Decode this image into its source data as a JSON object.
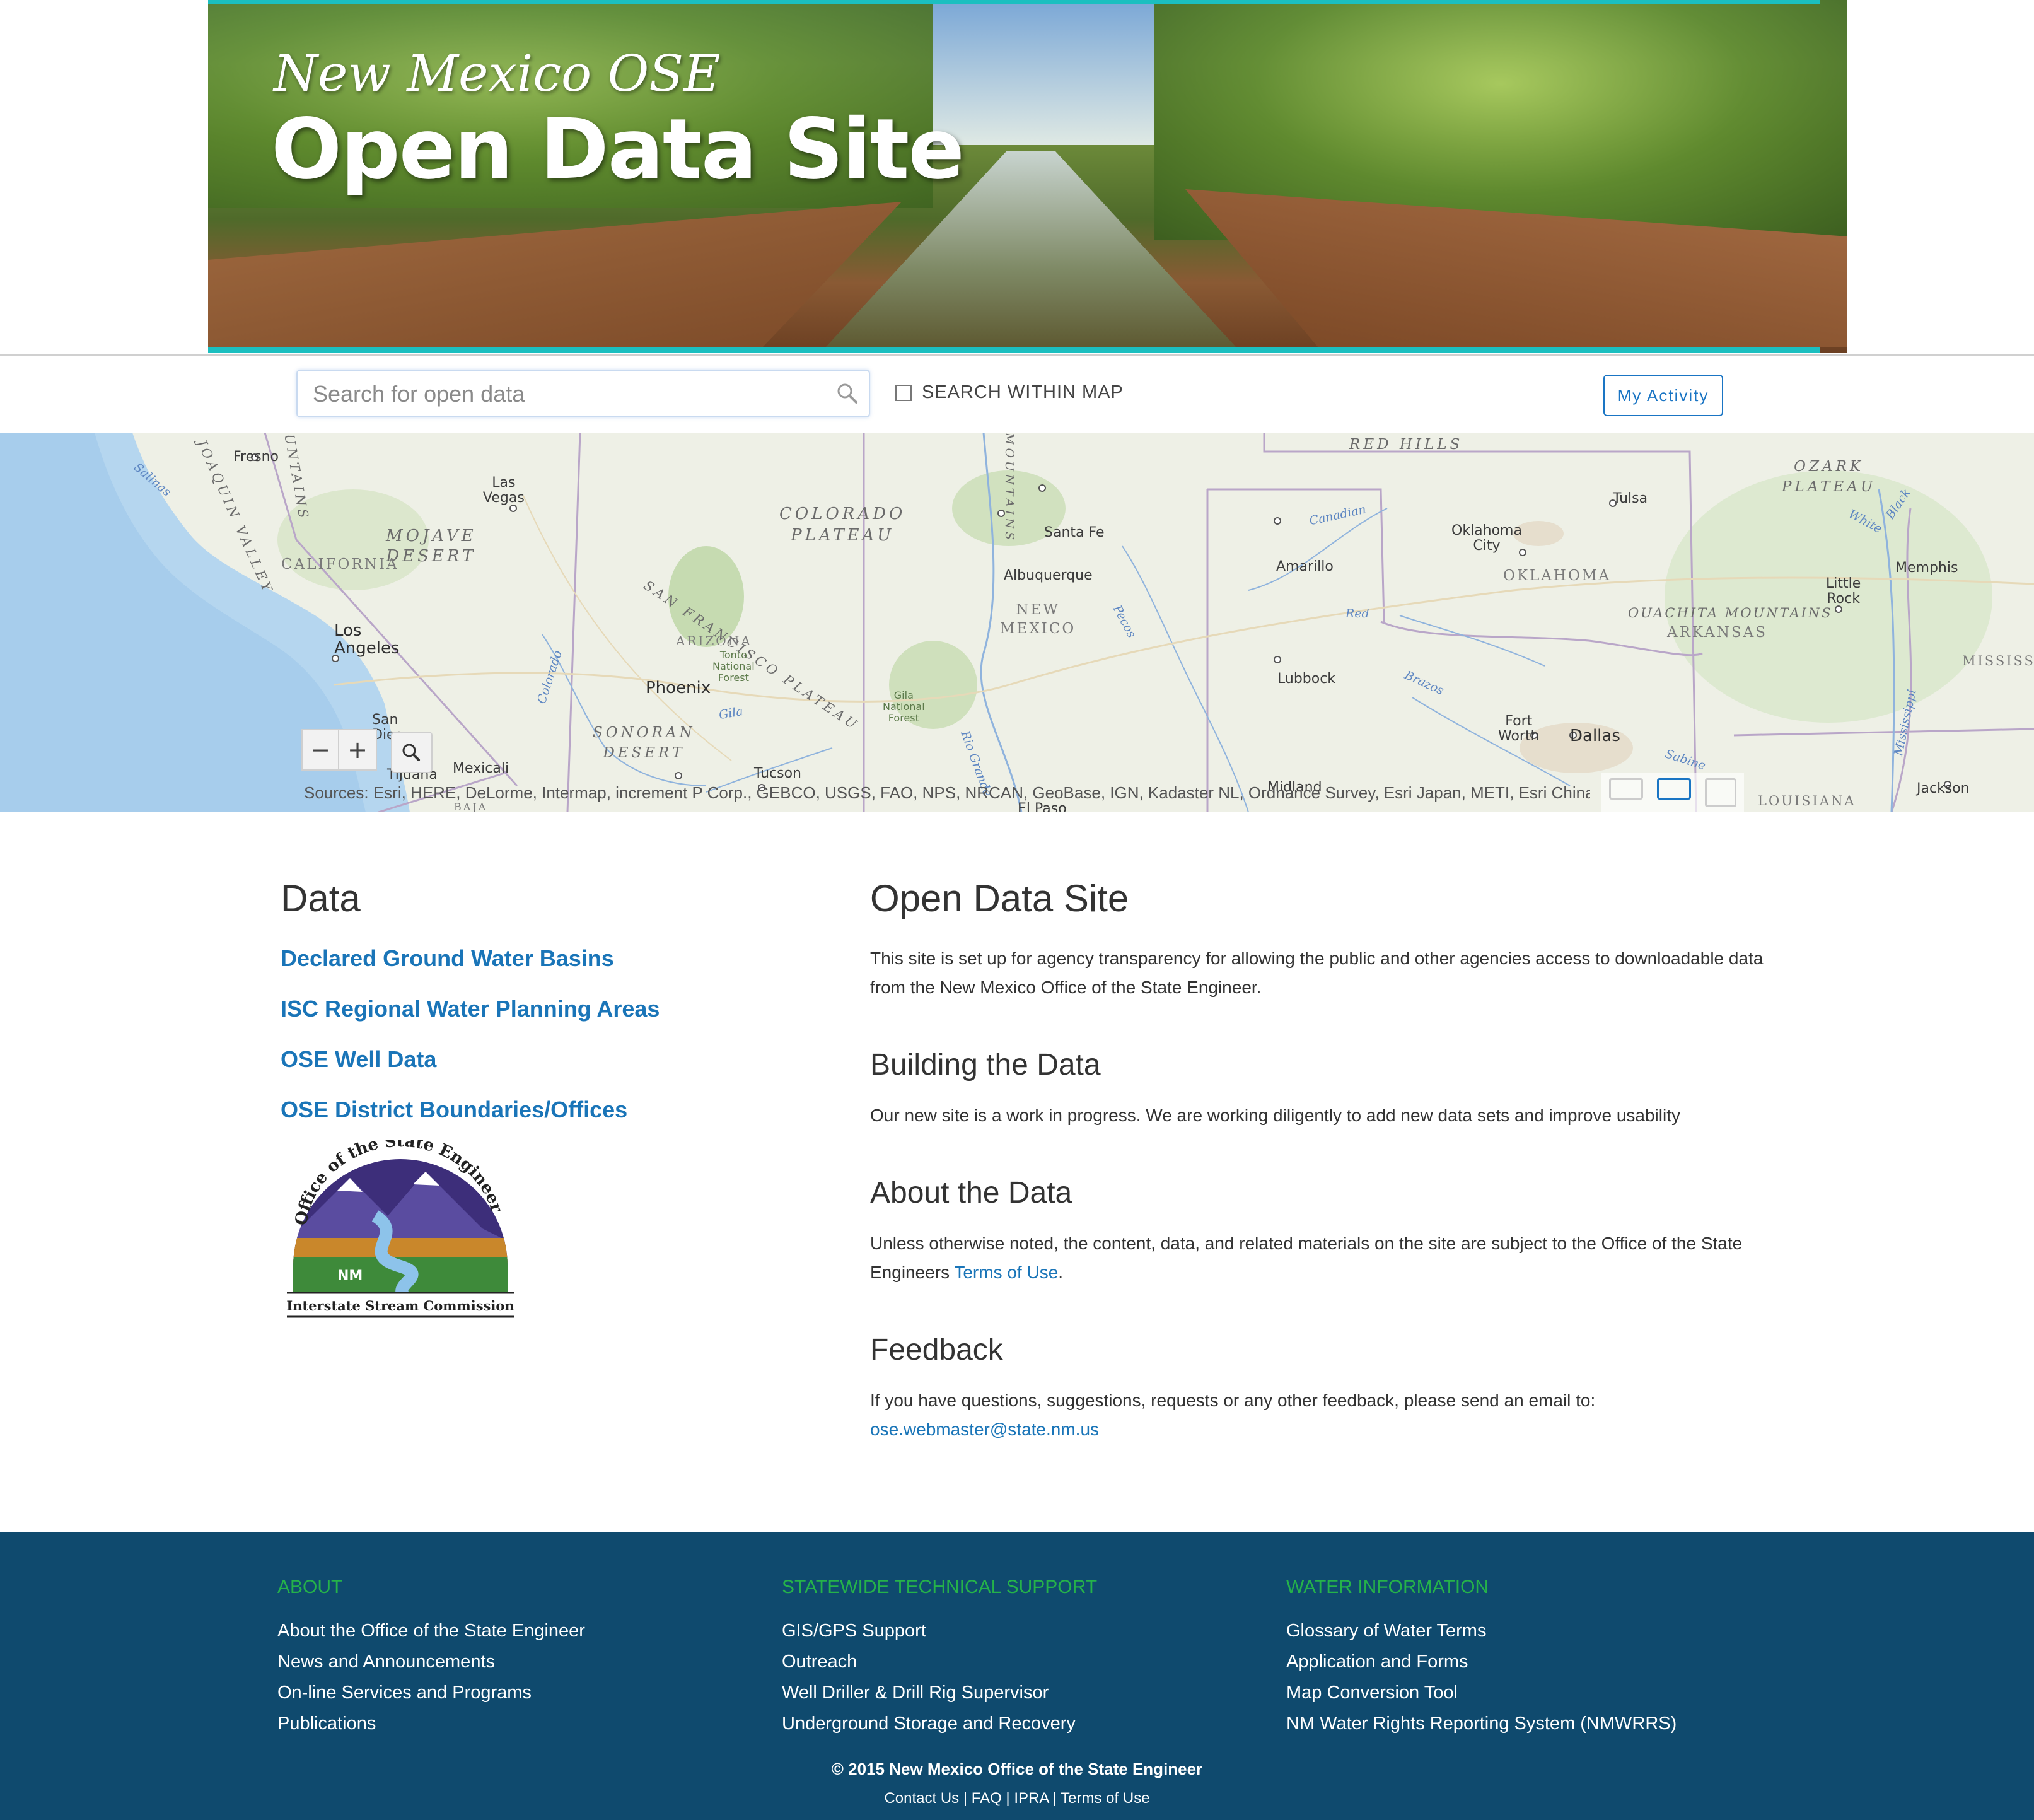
{
  "banner": {
    "subtitle": "New Mexico OSE",
    "title": "Open Data Site"
  },
  "search": {
    "placeholder": "Search for open data",
    "within_map_label": "SEARCH WITHIN MAP",
    "my_activity_label": "My Activity"
  },
  "map": {
    "zoom_out": "−",
    "zoom_in": "+",
    "attribution": "Sources: Esri, HERE, DeLorme, Intermap, increment P Corp., GEBCO, USGS, FAO, NPS, NRCAN, GeoBase, IGN, Kadaster NL, Ordnance Survey, Esri Japan, METI, Esri China (H",
    "labels": {
      "fresno": "Fresno",
      "las_vegas": "Las\nVegas",
      "mojave": "MOJAVE\nDESERT",
      "california": "CALIFORNIA",
      "los_angeles": "Los\nAngeles",
      "san_diego": "San\nDieg",
      "tijuana": "Tijuana",
      "mexicali": "Mexicali",
      "baja": "BAJA",
      "colorado_plateau": "COLORADO\nPLATEAU",
      "sf_plateau": "SAN FRANCISCO PLATEAU",
      "arizona": "ARIZONA",
      "tonto": "Tonto\nNational\nForest",
      "phoenix": "Phoenix",
      "sonoran": "SONORAN\nDESERT",
      "tucson": "Tucson",
      "gila_forest": "Gila\nNational\nForest",
      "santa_fe": "Santa Fe",
      "albuquerque": "Albuquerque",
      "new_mexico": "NEW\nMEXICO",
      "el_paso": "El Paso",
      "red_hills": "RED HILLS",
      "amarillo": "Amarillo",
      "lubbock": "Lubbock",
      "midland": "Midland",
      "oklahoma_city": "Oklahoma\nCity",
      "oklahoma": "OKLAHOMA",
      "tulsa": "Tulsa",
      "fort_worth": "Fort\nWorth",
      "dallas": "Dallas",
      "ozark": "OZARK\nPLATEAU",
      "ouachita": "OUACHITA MOUNTAINS",
      "arkansas": "ARKANSAS",
      "little_rock": "Little\nRock",
      "memphis": "Memphis",
      "mississippi": "MISSISSIPI",
      "jackson": "Jackson",
      "louisiana": "LOUISIANA",
      "canadian": "Canadian",
      "red": "Red",
      "brazos": "Brazos",
      "pecos": "Pecos",
      "sabine": "Sabine",
      "gila": "Gila",
      "colorado_river": "Colorado",
      "rio_grande": "Rio Grande",
      "salinas": "Salinas",
      "white": "White",
      "black": "Black",
      "mississippi_river": "Mississippi",
      "joaquin": "JOAQUIN VALLEY",
      "mountains": "UNTAINS",
      "mountains2": "MOUNTAINS"
    }
  },
  "data_section": {
    "heading": "Data",
    "links": [
      "Declared Ground Water Basins",
      "ISC Regional Water Planning Areas",
      "OSE Well Data",
      "OSE District Boundaries/Offices"
    ]
  },
  "logo": {
    "arc_text": "Office of the State Engineer",
    "center_text": "NM",
    "bottom_text": "Interstate Stream Commission"
  },
  "info": {
    "heading": "Open Data Site",
    "intro": "This site is set up for agency transparency for allowing the public and other agencies access to downloadable data from the New Mexico Office of the State Engineer.",
    "building_heading": "Building the Data",
    "building_text": "Our new site is a work in progress. We are working diligently to add new data sets and improve usability",
    "about_heading": "About the Data",
    "about_text_before": "Unless otherwise noted, the content, data, and related materials on the site are subject to the Office of the State Engineers ",
    "about_link": "Terms of Use",
    "about_text_after": ".",
    "feedback_heading": "Feedback",
    "feedback_text": "If you have questions, suggestions, requests or any other feedback, please send an email to:",
    "feedback_email": "ose.webmaster@state.nm.us"
  },
  "footer": {
    "about": {
      "heading": "ABOUT",
      "links": [
        "About the Office of the State Engineer",
        "News and Announcements",
        "On-line Services and Programs",
        "Publications"
      ]
    },
    "support": {
      "heading": "STATEWIDE TECHNICAL SUPPORT",
      "links": [
        "GIS/GPS Support",
        "Outreach",
        "Well Driller & Drill Rig Supervisor",
        "Underground Storage and Recovery"
      ]
    },
    "water": {
      "heading": "WATER INFORMATION",
      "links": [
        "Glossary of Water Terms",
        "Application and Forms",
        "Map Conversion Tool",
        "NM Water Rights Reporting System (NMWRRS)"
      ]
    },
    "copyright": "© 2015 New Mexico Office of the State Engineer",
    "bottom_links": [
      "Contact Us",
      "FAQ",
      "IPRA",
      "Terms of Use"
    ],
    "separator": " | "
  },
  "colors": {
    "accent_teal": "#1bbfc0",
    "link_blue": "#1a75b8",
    "footer_bg": "#0f4a6e",
    "footer_heading_green": "#25b24a"
  }
}
